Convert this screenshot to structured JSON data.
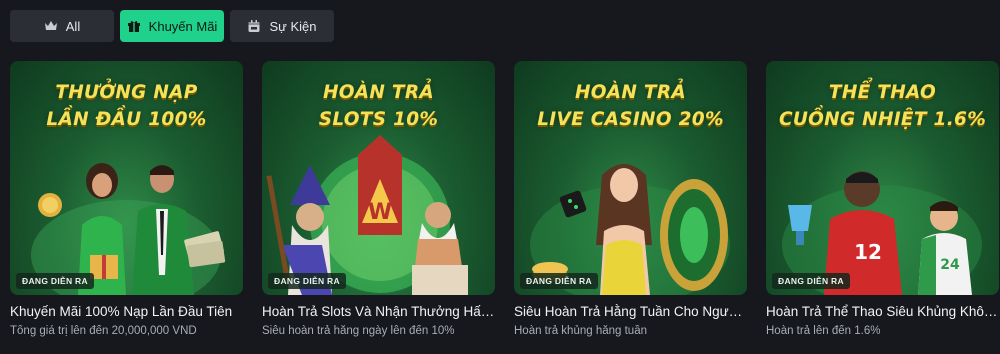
{
  "tabs": [
    {
      "label": "All",
      "icon": "crown-icon",
      "active": false
    },
    {
      "label": "Khuyến Mãi",
      "icon": "gift-icon",
      "active": true
    },
    {
      "label": "Sự Kiện",
      "icon": "calendar-icon",
      "active": false
    }
  ],
  "colors": {
    "accent": "#20d18b",
    "headline": "#f4e35a",
    "background": "#16181d"
  },
  "promotions": [
    {
      "headline_line1": "THƯỞNG NẠP",
      "headline_line2": "LẦN ĐẦU 100%",
      "badge": "ĐANG DIỄN RA",
      "title": "Khuyến Mãi 100% Nạp Lần Đầu Tiên",
      "subtitle": "Tổng giá trị lên đến 20,000,000 VND"
    },
    {
      "headline_line1": "HOÀN TRẢ",
      "headline_line2": "SLOTS 10%",
      "badge": "ĐANG DIỄN RA",
      "title": "Hoàn Trả Slots Và Nhận Thưởng Hấp Dẫn",
      "subtitle": "Siêu hoàn trả hằng ngày lên đến 10%"
    },
    {
      "headline_line1": "HOÀN TRẢ",
      "headline_line2": "LIVE CASINO 20%",
      "badge": "ĐANG DIỄN RA",
      "title": "Siêu Hoàn Trả Hằng Tuần Cho Người Chơi",
      "subtitle": "Hoàn trả khủng hằng tuần"
    },
    {
      "headline_line1": "THỂ THAO",
      "headline_line2": "CUỒNG NHIỆT 1.6%",
      "badge": "ĐANG DIỄN RA",
      "title": "Hoàn Trả Thể Thao Siêu Khủng Không Giới Hạn",
      "subtitle": "Hoàn trả lên đến 1.6%"
    }
  ]
}
